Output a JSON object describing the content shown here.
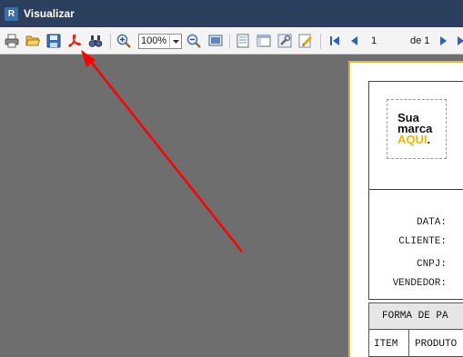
{
  "window": {
    "app_icon_letter": "R",
    "title": "Visualizar"
  },
  "toolbar": {
    "buttons": [
      {
        "name": "print-button",
        "icon": "printer-icon"
      },
      {
        "name": "open-button",
        "icon": "folder-open-icon"
      },
      {
        "name": "save-button",
        "icon": "floppy-disk-icon"
      },
      {
        "name": "export-pdf-button",
        "icon": "pdf-icon"
      },
      {
        "name": "find-button",
        "icon": "binoculars-icon"
      },
      {
        "name": "zoom-in-button",
        "icon": "zoom-in-icon"
      },
      {
        "name": "zoom-out-button",
        "icon": "zoom-out-icon"
      },
      {
        "name": "fit-page-button",
        "icon": "monitor-icon"
      },
      {
        "name": "single-page-button",
        "icon": "single-page-icon"
      },
      {
        "name": "page-layout-button",
        "icon": "layout-icon"
      },
      {
        "name": "settings-button",
        "icon": "wrench-icon"
      },
      {
        "name": "edit-button",
        "icon": "pencil-icon"
      },
      {
        "name": "first-page-button",
        "icon": "first-page-icon"
      },
      {
        "name": "previous-page-button",
        "icon": "previous-page-icon"
      },
      {
        "name": "next-page-button",
        "icon": "next-page-icon"
      },
      {
        "name": "last-page-button",
        "icon": "last-page-icon"
      }
    ],
    "zoom_value": "100%",
    "page_current": "1",
    "page_of_label": "de 1"
  },
  "colors": {
    "titlebar": "#2d3f5e",
    "toolbar": "#f4f4f4",
    "workspace": "#6e6e6e",
    "page_border": "#e2b33d",
    "annotation_arrow": "#ff0000",
    "logo_accent": "#f2b705"
  },
  "report": {
    "logo": {
      "line1": "Sua",
      "line2": "marca",
      "line3": "AQUI",
      "line3_suffix": "."
    },
    "labels": {
      "data": "DATA:",
      "cliente": "CLIENTE:",
      "cnpj": "CNPJ:",
      "vendedor": "VENDEDOR:"
    },
    "section_title": "FORMA DE PA",
    "columns": {
      "item": "ITEM",
      "produto": "PRODUTO"
    }
  },
  "annotation": {
    "type": "arrow",
    "points_to": "export-pdf-button"
  }
}
